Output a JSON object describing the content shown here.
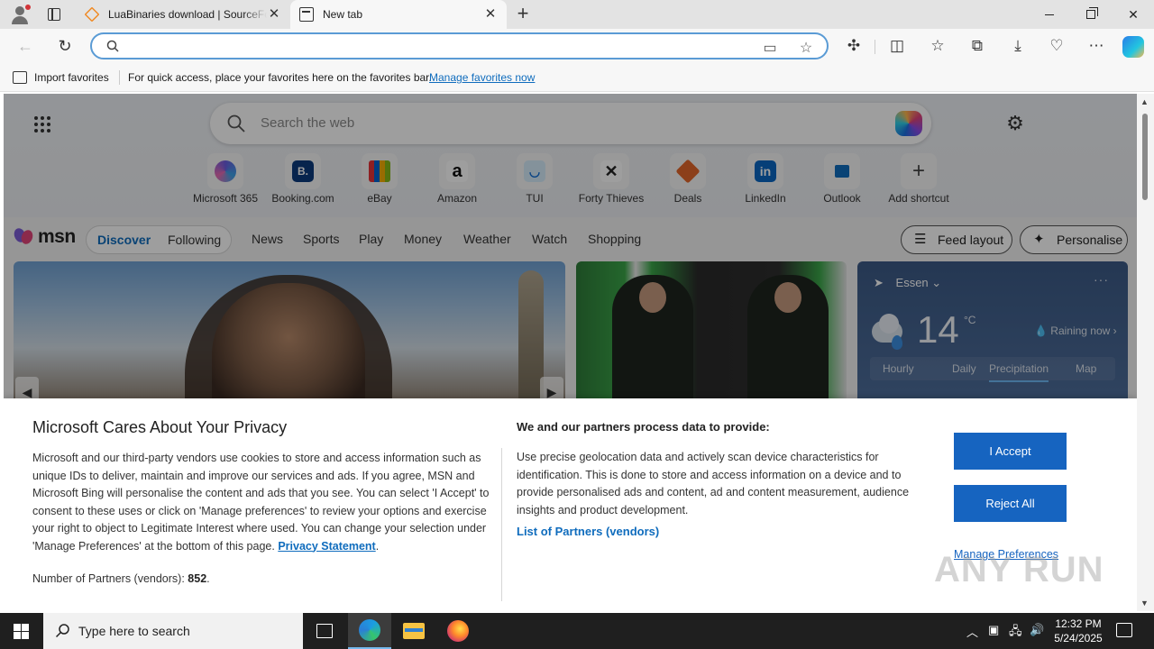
{
  "browser": {
    "tabs": [
      {
        "title": "LuaBinaries download | SourceForge.net",
        "active": false
      },
      {
        "title": "New tab",
        "active": true
      }
    ],
    "address": {
      "value": "",
      "placeholder": ""
    },
    "favorites_bar": {
      "import_label": "Import favorites",
      "hint": "For quick access, place your favorites here on the favorites bar.",
      "manage_link": "Manage favorites now"
    }
  },
  "ntp": {
    "search_placeholder": "Search the web",
    "shortcuts": [
      {
        "label": "Microsoft 365",
        "icon": "microsoft-365-icon",
        "color": "#7b61d8"
      },
      {
        "label": "Booking.com",
        "icon": "booking-icon",
        "color": "#0c3b7c",
        "glyph": "B."
      },
      {
        "label": "eBay",
        "icon": "ebay-icon",
        "color": "#e53238"
      },
      {
        "label": "Amazon",
        "icon": "amazon-icon",
        "color": "#ffffff",
        "glyph": "a"
      },
      {
        "label": "TUI",
        "icon": "tui-icon",
        "color": "#0d6cd6"
      },
      {
        "label": "Forty Thieves",
        "icon": "forty-thieves-icon",
        "color": "#222222"
      },
      {
        "label": "Deals",
        "icon": "deals-icon",
        "color": "#e3672b"
      },
      {
        "label": "LinkedIn",
        "icon": "linkedin-icon",
        "color": "#0a66c2",
        "glyph": "in"
      },
      {
        "label": "Outlook",
        "icon": "outlook-icon",
        "color": "#0f6cbd"
      },
      {
        "label": "Add shortcut",
        "icon": "plus-icon",
        "color": "#f7f7f7",
        "glyph": "+"
      }
    ],
    "msn": {
      "logo_text": "msn",
      "pills": {
        "discover": "Discover",
        "following": "Following"
      },
      "nav": [
        "News",
        "Sports",
        "Play",
        "Money",
        "Weather",
        "Watch",
        "Shopping"
      ],
      "feed_layout": "Feed layout",
      "personalise": "Personalise"
    },
    "weather": {
      "location": "Essen",
      "temperature": "14",
      "unit": "°C",
      "condition": "Raining now",
      "tabs": [
        "Hourly",
        "Daily",
        "Precipitation",
        "Map"
      ],
      "selected_tab": "Precipitation"
    }
  },
  "privacy": {
    "title": "Microsoft Cares About Your Privacy",
    "body": "Microsoft and our third-party vendors use cookies to store and access information such as unique IDs to deliver, maintain and improve our services and ads. If you agree, MSN and Microsoft Bing will personalise the content and ads that you see. You can select 'I Accept' to consent to these uses or click on 'Manage preferences' to review your options and exercise your right to object to Legitimate Interest where used.  You can change your selection under 'Manage Preferences' at the bottom of this page.",
    "privacy_link": "Privacy Statement",
    "partners_label": "Number of Partners (vendors):",
    "partners_count": "852",
    "subheading": "We and our partners process data to provide:",
    "purposes": "Use precise geolocation data and actively scan device characteristics for identification. This is done to store and access information on a device and to provide personalised ads and content, ad and content measurement, audience insights and product development.",
    "vendors_link": "List of Partners (vendors)",
    "accept": "I Accept",
    "reject": "Reject All",
    "manage": "Manage Preferences"
  },
  "watermark": "ANY RUN",
  "taskbar": {
    "search_placeholder": "Type here to search",
    "time": "12:32 PM",
    "date": "5/24/2025"
  }
}
